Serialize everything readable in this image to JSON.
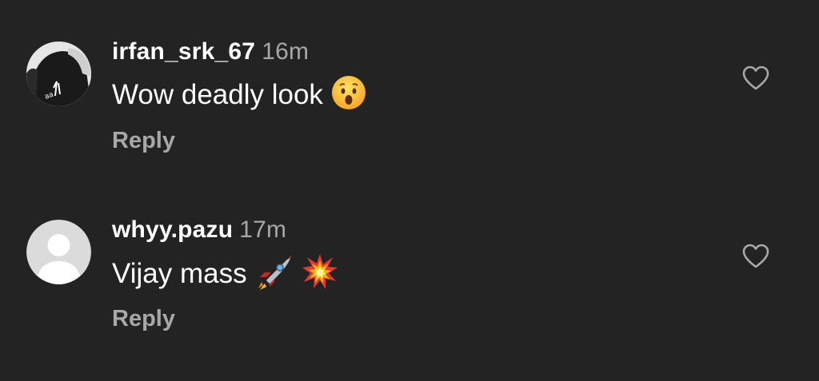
{
  "comments": [
    {
      "username": "irfan_srk_67",
      "time": "16m",
      "text": "Wow deadly look",
      "emoji": [
        "astonished-face"
      ],
      "reply_label": "Reply",
      "avatar": "photo-avatar",
      "like_icon": "heart-outline-icon"
    },
    {
      "username": "whyy.pazu",
      "time": "17m",
      "text": "Vijay mass",
      "emoji": [
        "rocket",
        "collision"
      ],
      "reply_label": "Reply",
      "avatar": "default-avatar",
      "like_icon": "heart-outline-icon"
    }
  ],
  "colors": {
    "background": "#232323",
    "text_primary": "#ffffff",
    "text_secondary": "#a8a8a8"
  }
}
